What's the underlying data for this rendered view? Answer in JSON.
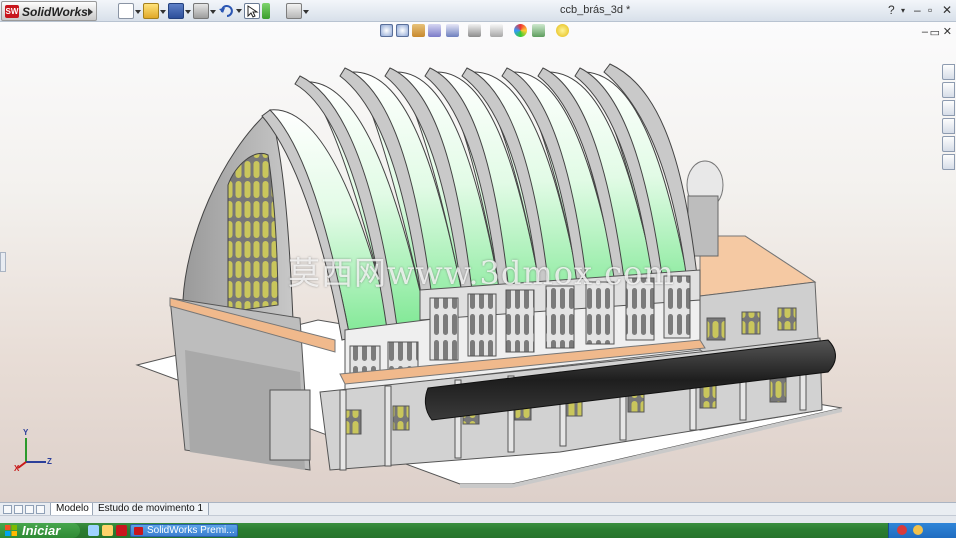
{
  "app": {
    "name": "SolidWorks",
    "document_title": "ccb_brás_3d *"
  },
  "toolbar": {
    "items": [
      "new-file-icon",
      "open-file-icon",
      "save-icon",
      "print-icon",
      "undo-icon",
      "select-icon",
      "rebuild-icon",
      "options-icon"
    ]
  },
  "window_controls": {
    "help": "?",
    "minimize": "–",
    "restore": "▫",
    "close": "✕"
  },
  "view_toolbar": {
    "items": [
      "zoom-to-fit-icon",
      "zoom-area-icon",
      "previous-view-icon",
      "section-view-icon",
      "view-orientation-icon",
      "display-style-icon",
      "hide-show-icon",
      "appearance-icon",
      "scene-icon",
      "view-settings-icon"
    ]
  },
  "watermark": "莫西网www.3dmox.com",
  "triad": {
    "x": "X",
    "y": "Y",
    "z": "Z"
  },
  "bottom_tabs": {
    "model": "Modelo",
    "motion_study": "Estudo de movimento 1"
  },
  "taskbar": {
    "start": "Iniciar",
    "task": "SolidWorks Premi..."
  },
  "colors": {
    "roof_green": "#8ef0a0",
    "arch_gray": "#c9c9c9",
    "ledge_orange": "#f0b98c",
    "window_olive": "#c6c45c",
    "canopy_black": "#2a2a2a",
    "taskbar_green": "#2b7d31",
    "brand_red": "#c8161d"
  }
}
